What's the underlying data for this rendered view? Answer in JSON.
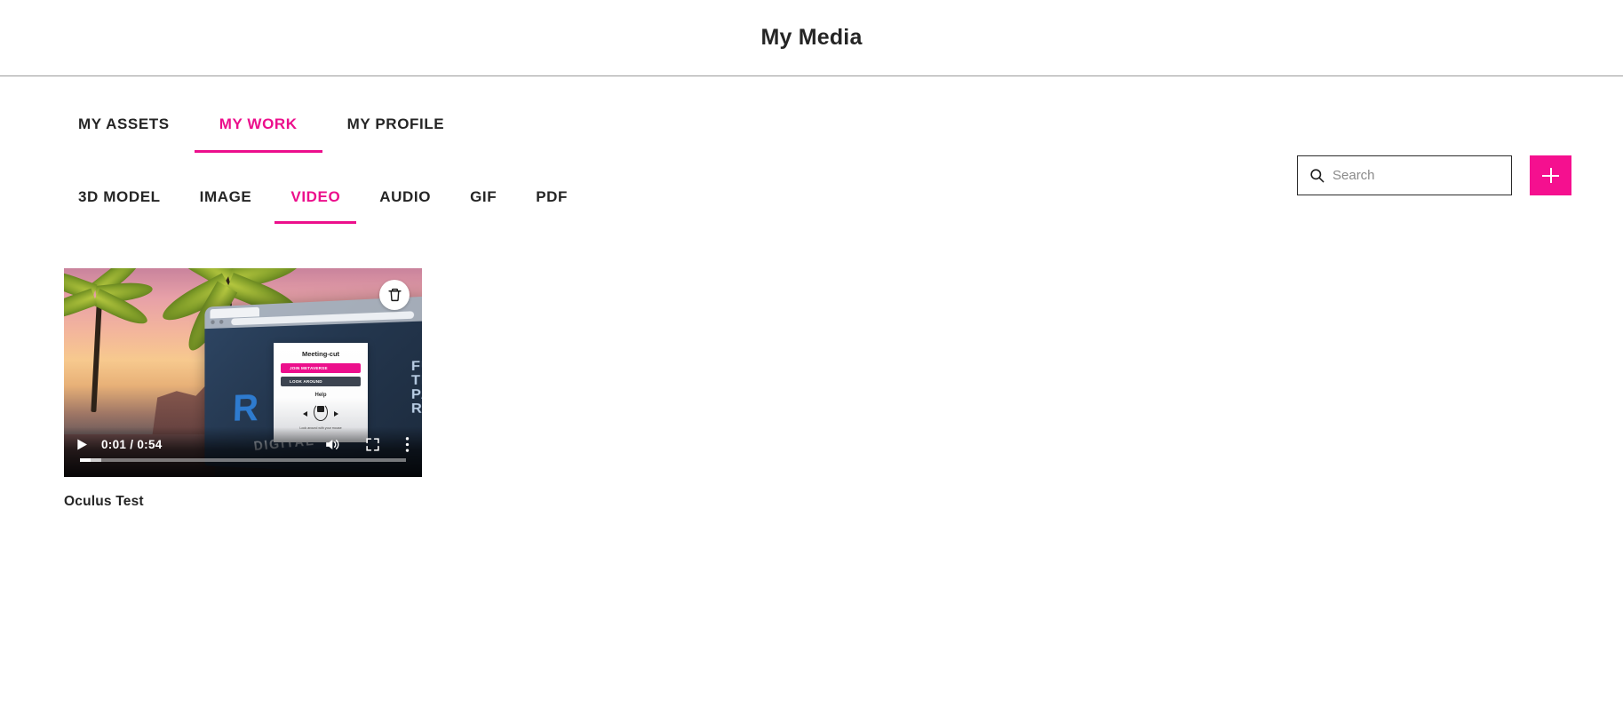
{
  "header": {
    "title": "My Media"
  },
  "primary_tabs": [
    {
      "label": "MY ASSETS",
      "active": false
    },
    {
      "label": "MY WORK",
      "active": true
    },
    {
      "label": "MY PROFILE",
      "active": false
    }
  ],
  "secondary_tabs": [
    {
      "label": "3D MODEL",
      "active": false
    },
    {
      "label": "IMAGE",
      "active": false
    },
    {
      "label": "VIDEO",
      "active": true
    },
    {
      "label": "AUDIO",
      "active": false
    },
    {
      "label": "GIF",
      "active": false
    },
    {
      "label": "PDF",
      "active": false
    }
  ],
  "search": {
    "placeholder": "Search",
    "value": "",
    "icon": "search-icon"
  },
  "add_button": {
    "icon": "plus-icon",
    "label": "+"
  },
  "colors": {
    "accent_pink": "#ec0f8c",
    "add_button_pink": "#f5108f",
    "text_dark": "#252525",
    "divider": "#9a9a9a"
  },
  "media_items": [
    {
      "title": "Oculus Test",
      "type": "video",
      "delete_icon": "trash-icon",
      "player": {
        "play_icon": "play-icon",
        "time": "0:01 / 0:54",
        "current_time": "0:01",
        "duration": "0:54",
        "volume_icon": "volume-icon",
        "fullscreen_icon": "fullscreen-icon",
        "more_icon": "more-vertical-icon",
        "progress_percent": 3.2
      },
      "thumbnail": {
        "scene_description": "VR sunset desert scene with palm trees and a floating browser window",
        "browser_dialog": {
          "title": "Meeting-cut",
          "join_button": "JOIN METAVERSE",
          "look_button": "LOOK AROUND",
          "help_label": "Help",
          "help_caption": "Look around with your mouse"
        },
        "brand_text": "R",
        "digital_text": "DIGITAL",
        "right_column_lines": [
          "FU",
          "TE",
          "PA",
          "RE"
        ]
      }
    }
  ]
}
